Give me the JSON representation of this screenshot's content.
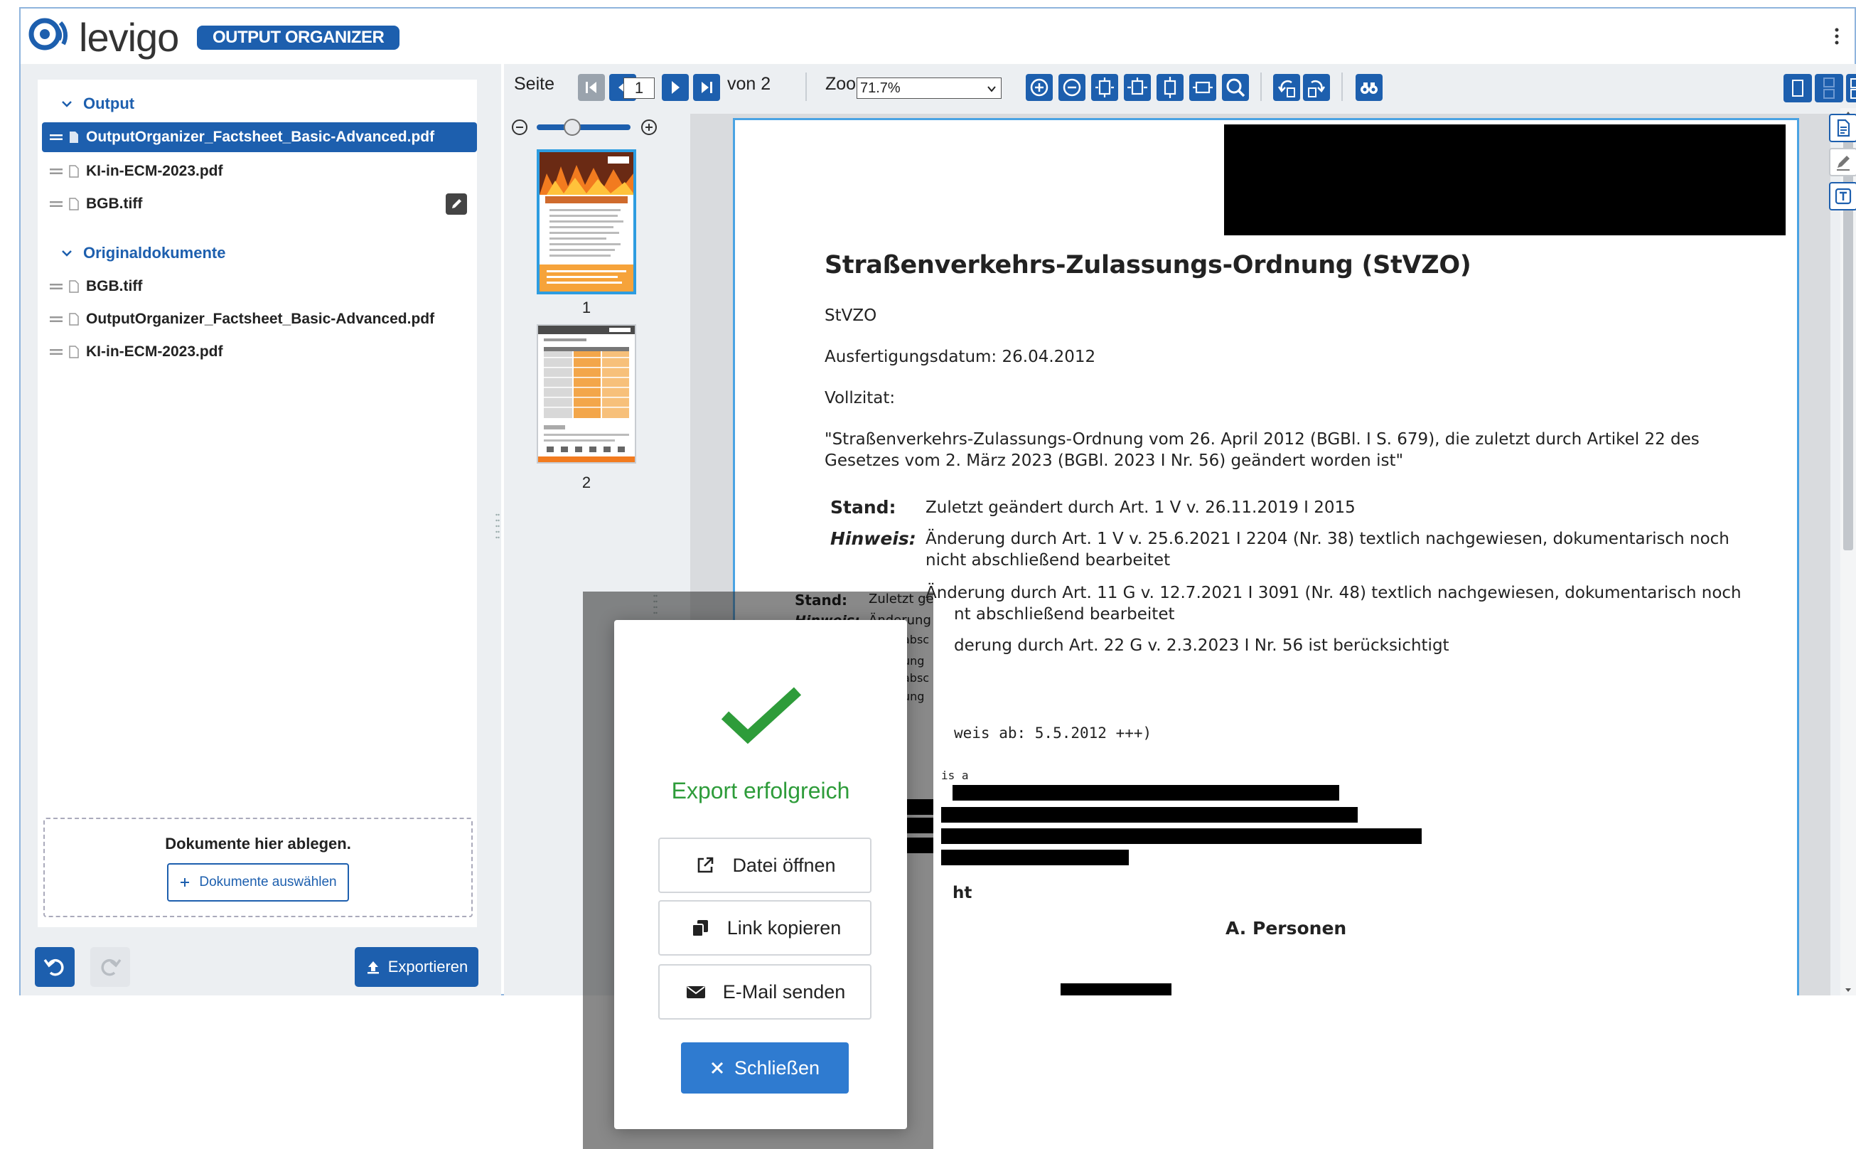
{
  "header": {
    "logo_text": "levigo",
    "app_badge": "OUTPUT ORGANIZER",
    "menu_icon": "kebab-menu-icon"
  },
  "sidebar": {
    "output_section": "Output",
    "output_files": [
      {
        "name": "OutputOrganizer_Factsheet_Basic-Advanced.pdf",
        "selected": true
      },
      {
        "name": "KI-in-ECM-2023.pdf",
        "selected": false
      },
      {
        "name": "BGB.tiff",
        "selected": false,
        "edit_icon": "pencil-icon"
      }
    ],
    "originals_section": "Originaldokumente",
    "original_files": [
      {
        "name": "BGB.tiff"
      },
      {
        "name": "OutputOrganizer_Factsheet_Basic-Advanced.pdf"
      },
      {
        "name": "KI-in-ECM-2023.pdf"
      }
    ],
    "dropzone_text": "Dokumente hier ablegen.",
    "choose_button": "Dokumente auswählen",
    "undo_icon": "undo-icon",
    "redo_icon": "redo-icon",
    "export_button": "Exportieren"
  },
  "viewer": {
    "page_label": "Seite",
    "current_page": "1",
    "of_label": "von 2",
    "zoom_label": "Zoom",
    "zoom_value": "71.7%",
    "thumbnails": [
      "1",
      "2"
    ],
    "document": {
      "title": "Straßenverkehrs-Zulassungs-Ordnung (StVZO)",
      "abbr": "StVZO",
      "date_line": "Ausfertigungsdatum: 26.04.2012",
      "vollzitat_label": "Vollzitat:",
      "citation_1": "\"Straßenverkehrs-Zulassungs-Ordnung vom 26. April 2012 (BGBl. I S. 679), die zuletzt durch Artikel 22 des",
      "citation_2": "Gesetzes vom 2. März 2023 (BGBl. 2023 I Nr. 56) geändert worden ist\"",
      "stand_label": "Stand:",
      "stand_text": "Zuletzt geändert durch Art. 1 V v. 26.11.2019 I 2015",
      "hinweis_label": "Hinweis:",
      "hinweis_1a": "Änderung durch Art. 1 V v. 25.6.2021 I 2204 (Nr. 38) textlich nachgewiesen, dokumentarisch noch",
      "hinweis_1b": "nicht abschließend bearbeitet",
      "hinweis_2a": "Änderung durch Art. 11 G v. 12.7.2021 I 3091 (Nr. 48) textlich nachgewiesen, dokumentarisch noch",
      "hinweis_2b": "nt abschließend bearbeitet",
      "hinweis_3": "derung durch Art. 22 G v. 2.3.2023 I Nr. 56 ist berücksichtigt",
      "mono_line": "weis ab: 5.5.2012 +++)",
      "mono_frag": "is a",
      "ht_frag": "ht",
      "section_heading": "A. Personen",
      "ghost_stand": "Stand:",
      "ghost_stand_val": "Zuletzt ge",
      "ghost_hinweis": "Hinweis:",
      "ghost_hinweis_val": "Änderung",
      "ghost_1": "absc",
      "ghost_2": "ung",
      "ghost_3": "absc",
      "ghost_4": "ung"
    }
  },
  "modal": {
    "icon": "checkmark-icon",
    "message": "Export erfolgreich",
    "open_file": "Datei öffnen",
    "copy_link": "Link kopieren",
    "send_email": "E-Mail senden",
    "close": "Schließen"
  },
  "colors": {
    "primary": "#1d5fae",
    "success": "#2e9c3a",
    "selection_border": "#2d9ce0",
    "panel_bg": "#eceff2"
  }
}
